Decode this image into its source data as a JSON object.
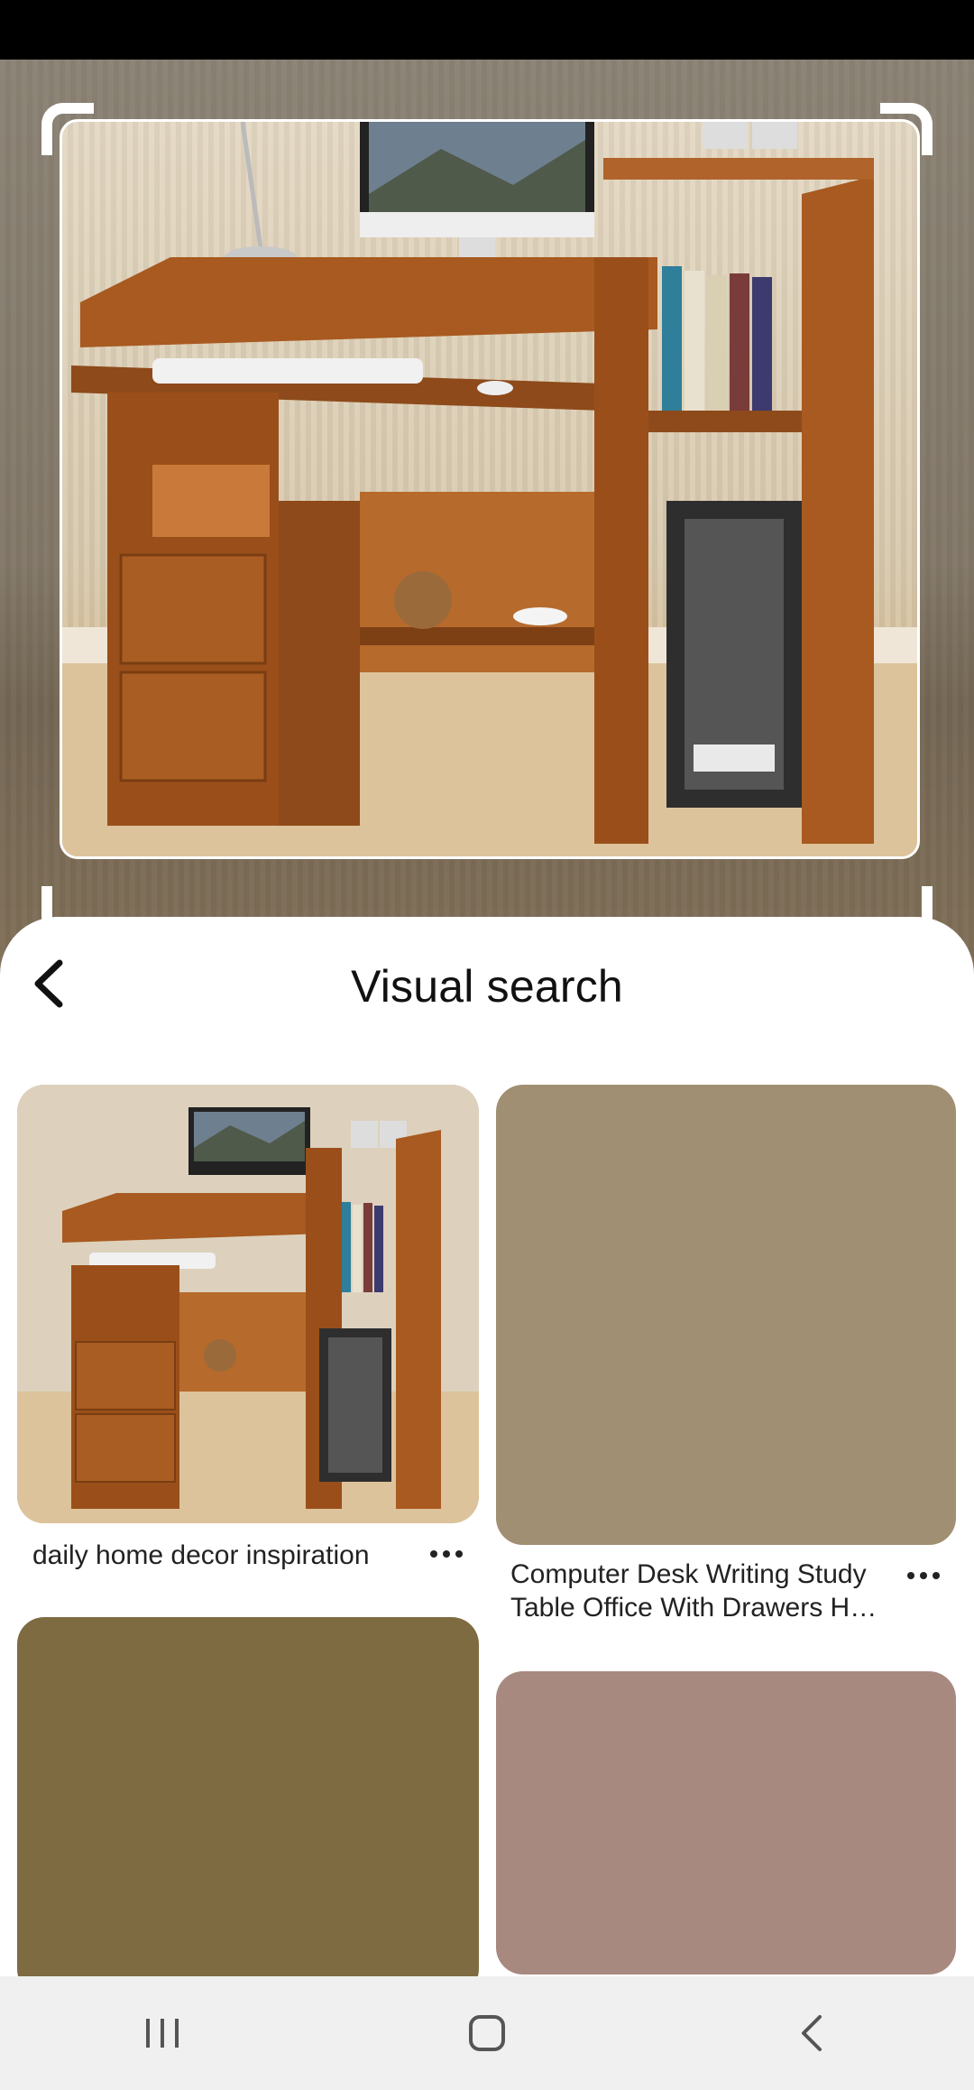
{
  "screen": {
    "title": "Visual search"
  },
  "colors": {
    "sheet_background": "#ffffff",
    "text_primary": "#111111",
    "nav_background": "#f0f0f0",
    "placeholder_1": "#a08f72",
    "placeholder_2": "#7f6b42",
    "placeholder_3": "#a7897f"
  },
  "icons": {
    "back": "chevron-left-icon",
    "more": "more-horizontal-icon",
    "nav_recents": "recents-icon",
    "nav_home": "home-icon",
    "nav_back": "back-icon"
  },
  "results": [
    {
      "title": "daily home decor inspiration",
      "image": "desk-photo"
    },
    {
      "title": "Computer Desk Writing Study Table Office With Drawers H…",
      "image": "placeholder"
    },
    {
      "title": "",
      "image": "placeholder"
    },
    {
      "title": "",
      "image": "placeholder"
    }
  ]
}
